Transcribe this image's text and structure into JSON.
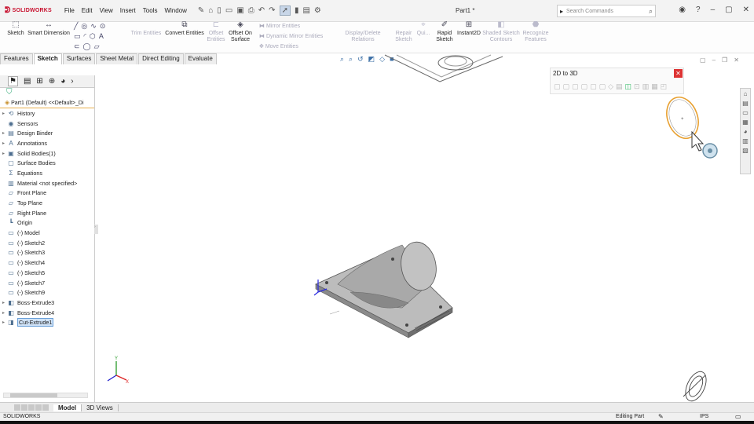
{
  "app": {
    "logo_text": "SOLIDWORKS",
    "doc_title": "Part1 *"
  },
  "menu": [
    "File",
    "Edit",
    "View",
    "Insert",
    "Tools",
    "Window"
  ],
  "search": {
    "placeholder": "Search Commands"
  },
  "ribbon": {
    "sketch": "Sketch",
    "smart_dimension": "Smart Dimension",
    "trim_entities": "Trim Entities",
    "convert_entities": "Convert Entities",
    "offset_entities": "Offset Entities",
    "offset_on_surface": "Offset On Surface",
    "mirror_entities": "Mirror Entities",
    "dynamic_mirror": "Dynamic Mirror Entities",
    "move_entities": "Move Entities",
    "display_delete_relations": "Display/Delete Relations",
    "repair_sketch": "Repair Sketch",
    "quick_snaps": "Qui...",
    "rapid_sketch": "Rapid Sketch",
    "instant2d": "Instant2D",
    "shaded_contours": "Shaded Sketch Contours",
    "recognize_features": "Recognize Features"
  },
  "tabs": [
    "Features",
    "Sketch",
    "Surfaces",
    "Sheet Metal",
    "Direct Editing",
    "Evaluate"
  ],
  "active_tab": "Sketch",
  "tree": {
    "root": "Part1 (Default) <<Default>_Di",
    "items": [
      {
        "label": "History",
        "icon": "history-icon",
        "expandable": true
      },
      {
        "label": "Sensors",
        "icon": "sensor-icon",
        "expandable": false
      },
      {
        "label": "Design Binder",
        "icon": "binder-icon",
        "expandable": true
      },
      {
        "label": "Annotations",
        "icon": "annotations-icon",
        "expandable": true
      },
      {
        "label": "Solid Bodies(1)",
        "icon": "solid-bodies-icon",
        "expandable": true
      },
      {
        "label": "Surface Bodies",
        "icon": "surface-bodies-icon",
        "expandable": false
      },
      {
        "label": "Equations",
        "icon": "equations-icon",
        "expandable": false
      },
      {
        "label": "Material <not specified>",
        "icon": "material-icon",
        "expandable": false
      },
      {
        "label": "Front Plane",
        "icon": "plane-icon",
        "expandable": false
      },
      {
        "label": "Top Plane",
        "icon": "plane-icon",
        "expandable": false
      },
      {
        "label": "Right Plane",
        "icon": "plane-icon",
        "expandable": false
      },
      {
        "label": "Origin",
        "icon": "origin-icon",
        "expandable": false
      },
      {
        "label": "(-) Model",
        "icon": "sketch-icon",
        "expandable": false
      },
      {
        "label": "(-) Sketch2",
        "icon": "sketch-icon",
        "expandable": false
      },
      {
        "label": "(-) Sketch3",
        "icon": "sketch-icon",
        "expandable": false
      },
      {
        "label": "(-) Sketch4",
        "icon": "sketch-icon",
        "expandable": false
      },
      {
        "label": "(-) Sketch5",
        "icon": "sketch-icon",
        "expandable": false
      },
      {
        "label": "(-) Sketch7",
        "icon": "sketch-icon",
        "expandable": false
      },
      {
        "label": "(-) Sketch9",
        "icon": "sketch-icon",
        "expandable": false
      },
      {
        "label": "Boss-Extrude3",
        "icon": "extrude-icon",
        "expandable": true
      },
      {
        "label": "Boss-Extrude4",
        "icon": "extrude-icon",
        "expandable": true
      },
      {
        "label": "Cut-Extrude1",
        "icon": "cut-extrude-icon",
        "expandable": true,
        "selected": true
      }
    ]
  },
  "toolbar_2d_to_3d": {
    "title": "2D to 3D"
  },
  "bottom_tabs": [
    "Model",
    "3D Views"
  ],
  "active_bottom_tab": "Model",
  "status": {
    "left": "SOLIDWORKS",
    "mode": "Editing Part",
    "units": "IPS"
  },
  "colors": {
    "brand": "#c8102e",
    "selection": "#cfe2f7",
    "sketch_highlight": "#e8a030"
  }
}
